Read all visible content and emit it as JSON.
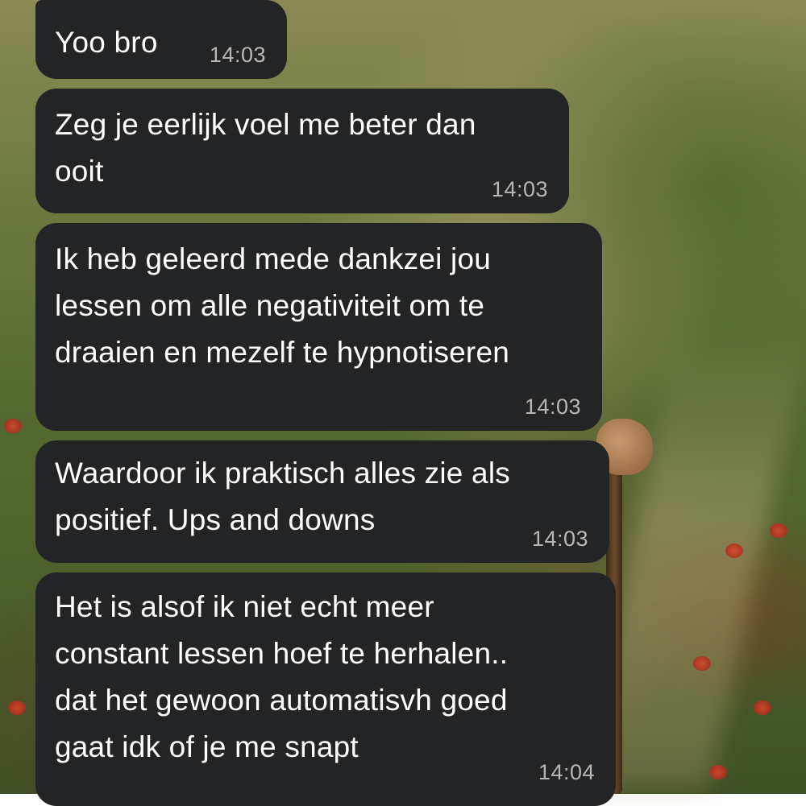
{
  "messages": [
    {
      "text": "Yoo bro",
      "time": "14:03"
    },
    {
      "text": "Zeg je eerlijk voel me beter dan\nooit",
      "time": "14:03"
    },
    {
      "text": "Ik heb geleerd mede dankzei jou\nlessen om alle negativiteit om te\ndraaien en mezelf te hypnotiseren",
      "time": "14:03"
    },
    {
      "text": "Waardoor ik praktisch alles zie als\npositief. Ups and downs",
      "time": "14:03"
    },
    {
      "text": "Het is alsof ik niet echt meer\nconstant lessen hoef te herhalen..\ndat het gewoon automatisvh goed\ngaat idk of je me snapt",
      "time": "14:04"
    }
  ],
  "colors": {
    "bubble_bg": "#232425",
    "text": "#ffffff",
    "timestamp": "#b7b7b7"
  },
  "wallpaper": "painted-meadow-with-walking-figure"
}
